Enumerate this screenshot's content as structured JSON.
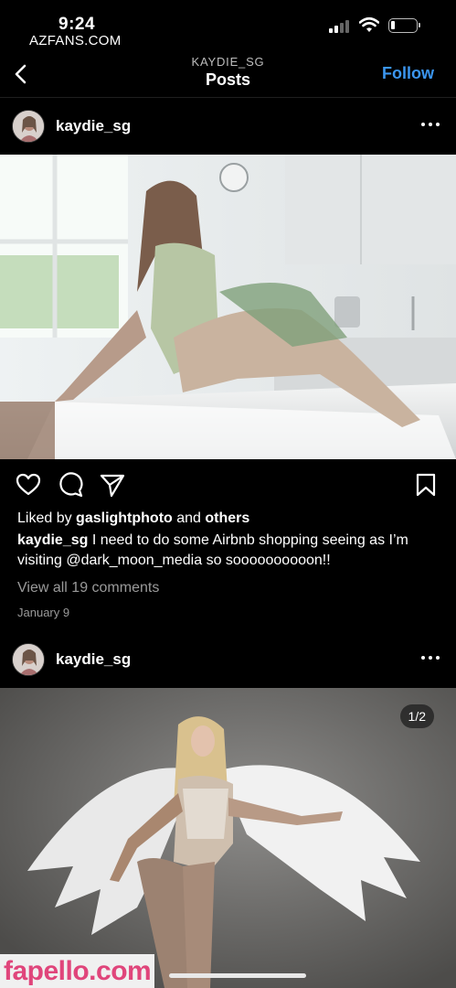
{
  "status": {
    "time": "9:24",
    "watermark_top": "AZFANS.COM"
  },
  "nav": {
    "subtitle": "KAYDIE_SG",
    "title": "Posts",
    "follow_label": "Follow"
  },
  "posts": [
    {
      "username": "kaydie_sg",
      "liked_prefix": "Liked by ",
      "liked_user": "gaslightphoto",
      "liked_mid": " and ",
      "liked_others": "others",
      "caption_user": "kaydie_sg",
      "caption_text": " I need to do some Airbnb shopping seeing as I’m visiting @dark_moon_media so soooooooooon!!",
      "comments_link": "View all 19 comments",
      "date": "January 9"
    },
    {
      "username": "kaydie_sg",
      "page_indicator": "1/2"
    }
  ],
  "watermark_bottom": "fapello.com",
  "icons": {
    "back": "chevron-left-icon",
    "more": "more-horizontal-icon",
    "like": "heart-icon",
    "comment": "comment-bubble-icon",
    "share": "paper-plane-icon",
    "save": "bookmark-icon"
  },
  "colors": {
    "background": "#000000",
    "accent": "#3b96f0",
    "secondary_text": "#9a9a9a",
    "watermark": "#e0457b"
  }
}
